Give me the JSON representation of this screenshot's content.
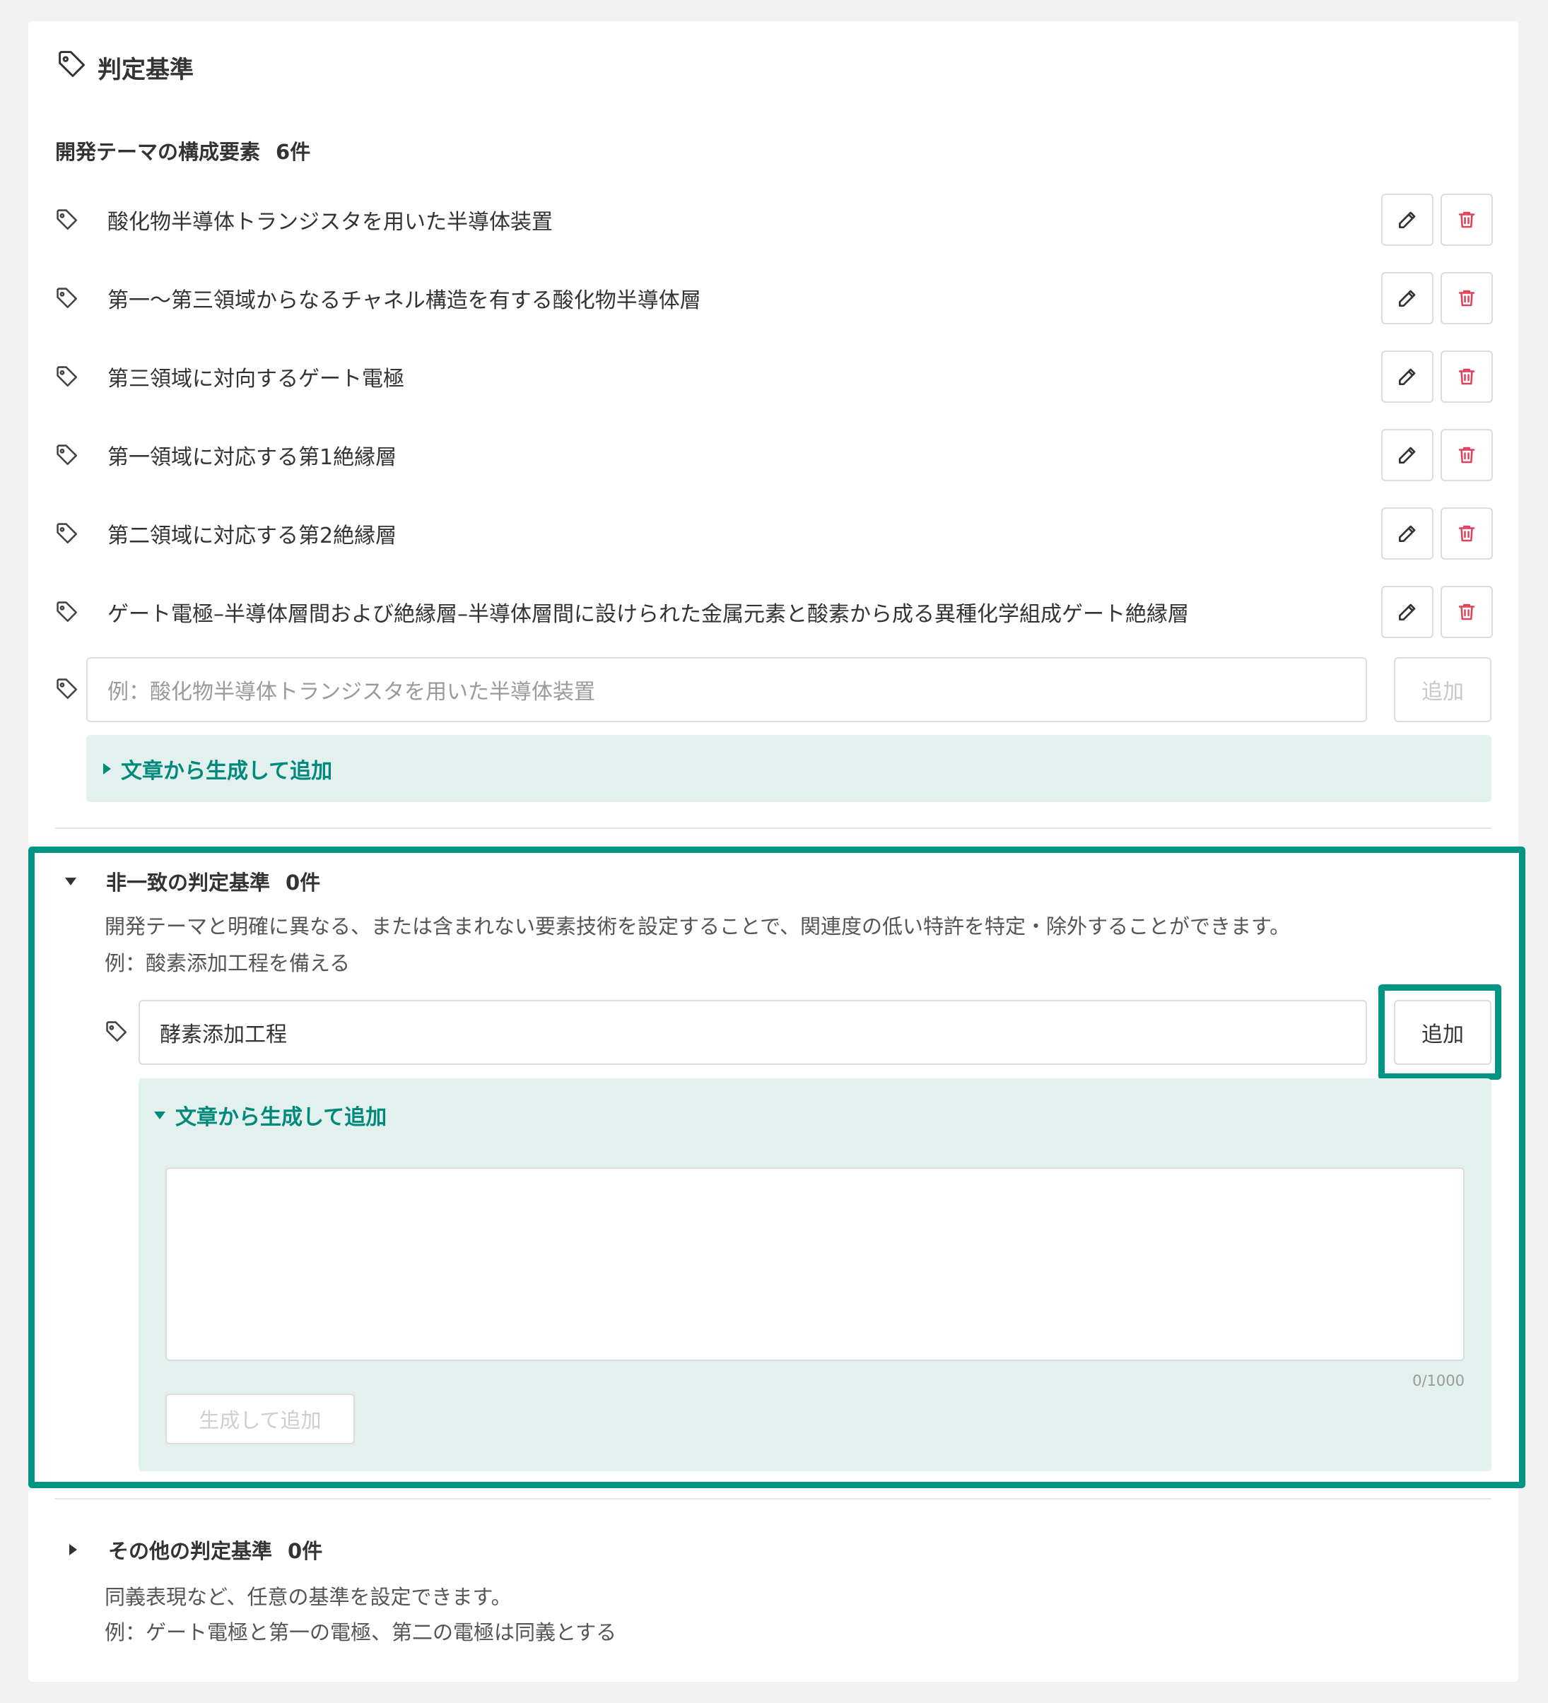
{
  "section_title": "判定基準",
  "constituent": {
    "heading": "開発テーマの構成要素",
    "count": "6件",
    "items": [
      {
        "label": "酸化物半導体トランジスタを用いた半導体装置"
      },
      {
        "label": "第一～第三領域からなるチャネル構造を有する酸化物半導体層"
      },
      {
        "label": "第三領域に対向するゲート電極"
      },
      {
        "label": "第一領域に対応する第1絶縁層"
      },
      {
        "label": "第二領域に対応する第2絶縁層"
      },
      {
        "label": "ゲート電極–半導体層間および絶縁層–半導体層間に設けられた金属元素と酸素から成る異種化学組成ゲート絶縁層"
      }
    ],
    "input_placeholder": "例：酸化物半導体トランジスタを用いた半導体装置",
    "add_label": "追加",
    "generate_label": "文章から生成して追加"
  },
  "mismatch": {
    "heading": "非一致の判定基準",
    "count": "0件",
    "description": "開発テーマと明確に異なる、または含まれない要素技術を設定することで、関連度の低い特許を特定・除外することができます。",
    "example": "例：酸素添加工程を備える",
    "input_value": "酵素添加工程",
    "add_label": "追加",
    "generate_label": "文章から生成して追加",
    "textarea_counter": "0/1000",
    "generate_button_label": "生成して追加"
  },
  "other": {
    "heading": "その他の判定基準",
    "count": "0件",
    "description": "同義表現など、任意の基準を設定できます。",
    "example": "例：ゲート電極と第一の電極、第二の電極は同義とする"
  },
  "colors": {
    "accent": "#009485",
    "accent_text": "#00897b",
    "panel_bg": "#e3f1ee",
    "delete_red": "#e0405a"
  },
  "icons": {
    "tag": "tag-icon",
    "edit": "pencil-icon",
    "delete": "trash-icon",
    "expand": "caret-right-icon",
    "collapse": "caret-down-icon"
  }
}
